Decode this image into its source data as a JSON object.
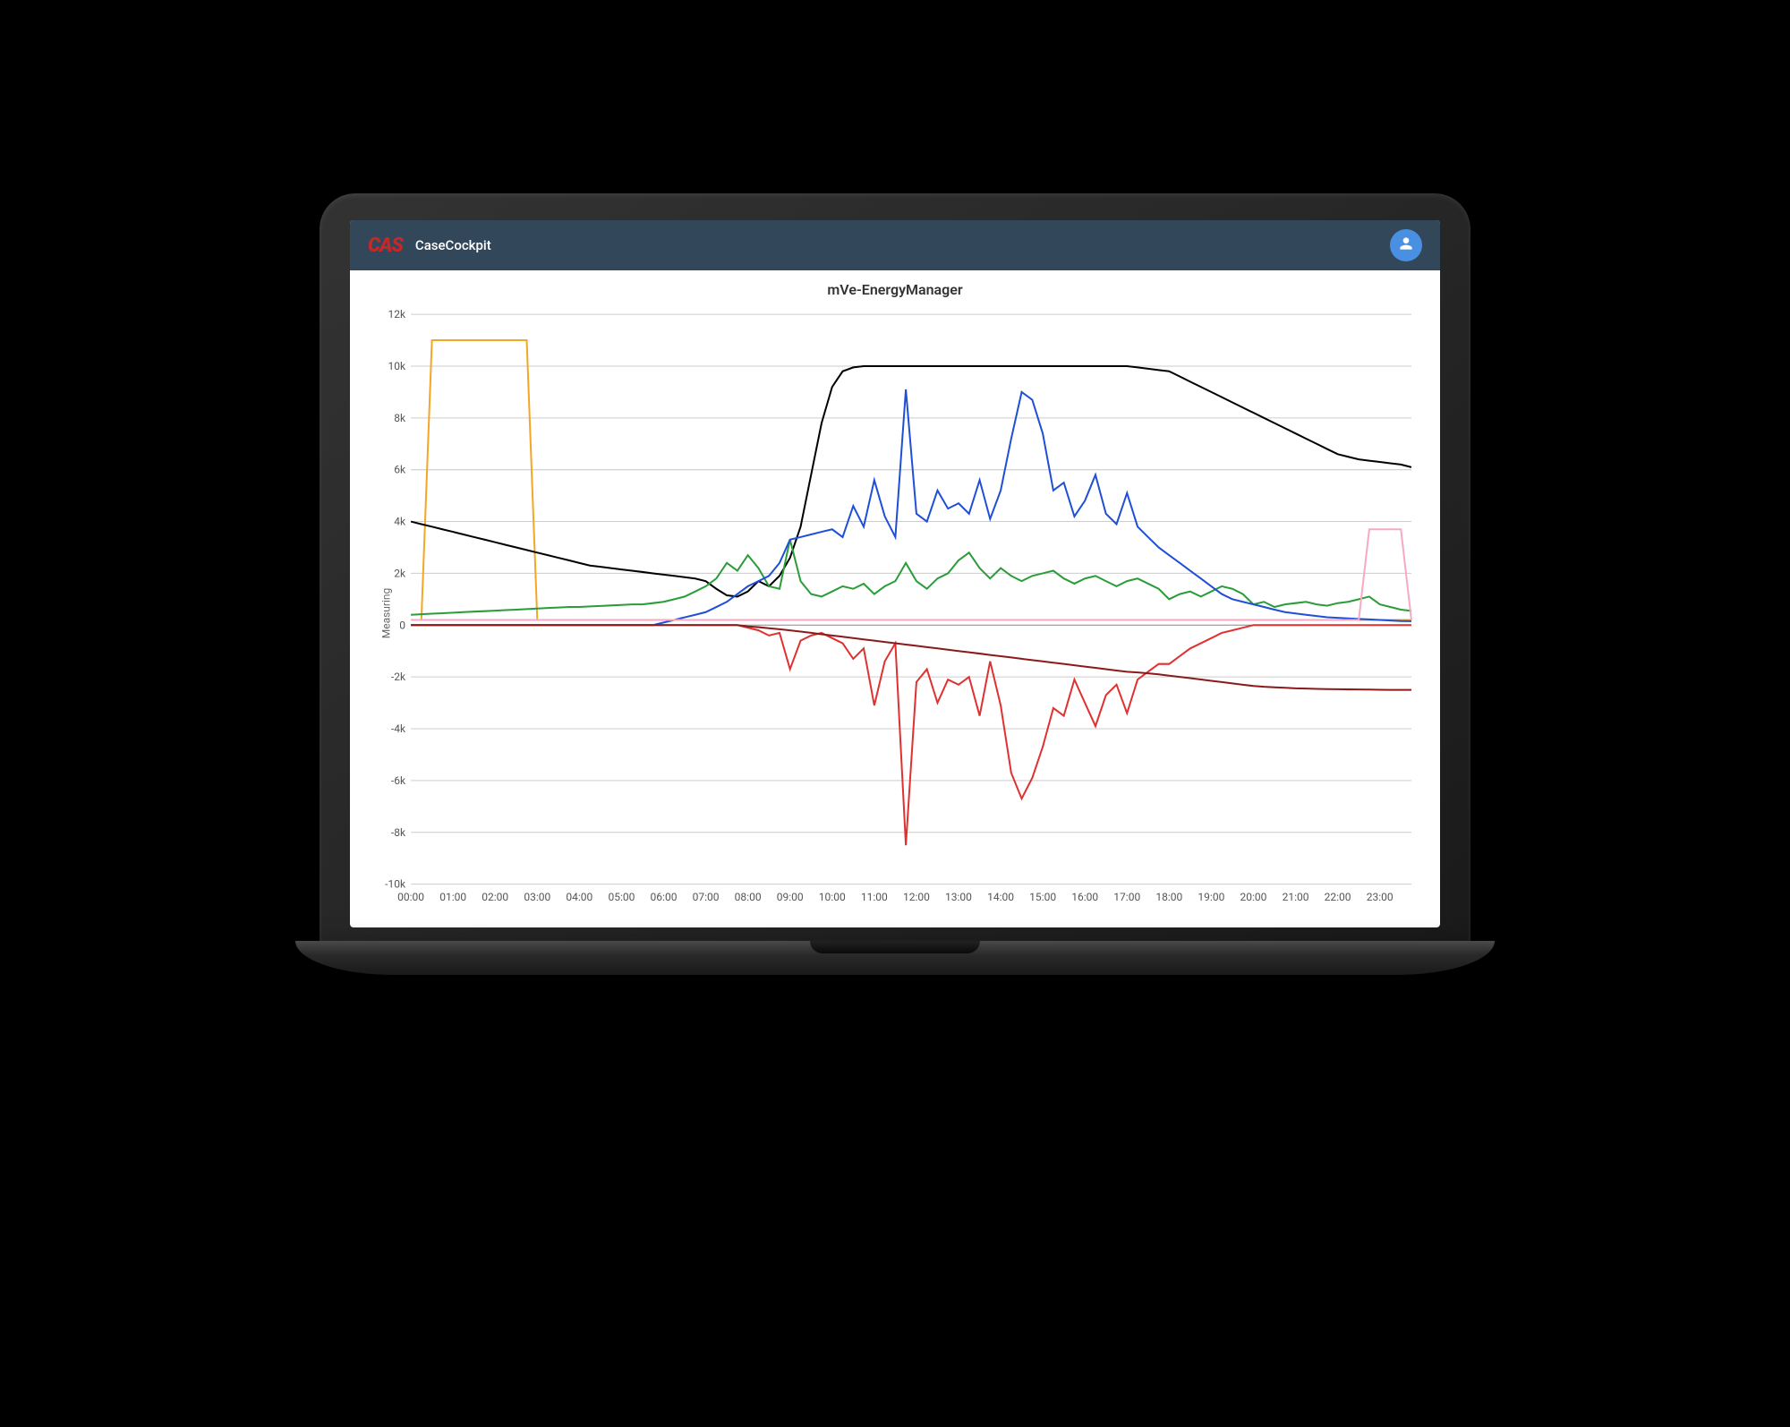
{
  "header": {
    "logo": "CAS",
    "app_name": "CaseCockpit"
  },
  "chart_data": {
    "type": "line",
    "title": "mVe-EnergyManager",
    "ylabel": "Measuring",
    "xlabel": "",
    "ylim": [
      -10000,
      12000
    ],
    "y_ticks": [
      -10000,
      -8000,
      -6000,
      -4000,
      -2000,
      0,
      2000,
      4000,
      6000,
      8000,
      10000,
      12000
    ],
    "y_tick_labels": [
      "-10k",
      "-8k",
      "-6k",
      "-4k",
      "-2k",
      "0",
      "2k",
      "4k",
      "6k",
      "8k",
      "10k",
      "12k"
    ],
    "x": [
      "00:00",
      "00:15",
      "00:30",
      "00:45",
      "01:00",
      "01:15",
      "01:30",
      "01:45",
      "02:00",
      "02:15",
      "02:30",
      "02:45",
      "03:00",
      "03:15",
      "03:30",
      "03:45",
      "04:00",
      "04:15",
      "04:30",
      "04:45",
      "05:00",
      "05:15",
      "05:30",
      "05:45",
      "06:00",
      "06:15",
      "06:30",
      "06:45",
      "07:00",
      "07:15",
      "07:30",
      "07:45",
      "08:00",
      "08:15",
      "08:30",
      "08:45",
      "09:00",
      "09:15",
      "09:30",
      "09:45",
      "10:00",
      "10:15",
      "10:30",
      "10:45",
      "11:00",
      "11:15",
      "11:30",
      "11:45",
      "12:00",
      "12:15",
      "12:30",
      "12:45",
      "13:00",
      "13:15",
      "13:30",
      "13:45",
      "14:00",
      "14:15",
      "14:30",
      "14:45",
      "15:00",
      "15:15",
      "15:30",
      "15:45",
      "16:00",
      "16:15",
      "16:30",
      "16:45",
      "17:00",
      "17:15",
      "17:30",
      "17:45",
      "18:00",
      "18:15",
      "18:30",
      "18:45",
      "19:00",
      "19:15",
      "19:30",
      "19:45",
      "20:00",
      "20:15",
      "20:30",
      "20:45",
      "21:00",
      "21:15",
      "21:30",
      "21:45",
      "22:00",
      "22:15",
      "22:30",
      "22:45",
      "23:00",
      "23:15",
      "23:30",
      "23:45"
    ],
    "x_tick_labels": [
      "00:00",
      "01:00",
      "02:00",
      "03:00",
      "04:00",
      "05:00",
      "06:00",
      "07:00",
      "08:00",
      "09:00",
      "10:00",
      "11:00",
      "12:00",
      "13:00",
      "14:00",
      "15:00",
      "16:00",
      "17:00",
      "18:00",
      "19:00",
      "20:00",
      "21:00",
      "22:00",
      "23:00"
    ],
    "series": [
      {
        "name": "orange",
        "color": "#f5a623",
        "values": [
          200,
          200,
          11000,
          11000,
          11000,
          11000,
          11000,
          11000,
          11000,
          11000,
          11000,
          11000,
          200,
          200,
          200,
          200,
          200,
          200,
          200,
          200,
          200,
          200,
          200,
          200,
          200,
          200,
          200,
          200,
          200,
          200,
          200,
          200,
          200,
          200,
          200,
          200,
          200,
          200,
          200,
          200,
          200,
          200,
          200,
          200,
          200,
          200,
          200,
          200,
          200,
          200,
          200,
          200,
          200,
          200,
          200,
          200,
          200,
          200,
          200,
          200,
          200,
          200,
          200,
          200,
          200,
          200,
          200,
          200,
          200,
          200,
          200,
          200,
          200,
          200,
          200,
          200,
          200,
          200,
          200,
          200,
          200,
          200,
          200,
          200,
          200,
          200,
          200,
          200,
          200,
          200,
          200,
          200,
          200,
          200,
          200,
          200
        ]
      },
      {
        "name": "black",
        "color": "#000000",
        "values": [
          4000,
          3900,
          3800,
          3700,
          3600,
          3500,
          3400,
          3300,
          3200,
          3100,
          3000,
          2900,
          2800,
          2700,
          2600,
          2500,
          2400,
          2300,
          2250,
          2200,
          2150,
          2100,
          2050,
          2000,
          1950,
          1900,
          1850,
          1800,
          1700,
          1400,
          1150,
          1100,
          1300,
          1700,
          1500,
          1900,
          2600,
          3800,
          5800,
          7800,
          9200,
          9800,
          9950,
          10000,
          10000,
          10000,
          10000,
          10000,
          10000,
          10000,
          10000,
          10000,
          10000,
          10000,
          10000,
          10000,
          10000,
          10000,
          10000,
          10000,
          10000,
          10000,
          10000,
          10000,
          10000,
          10000,
          10000,
          10000,
          10000,
          9950,
          9900,
          9850,
          9800,
          9600,
          9400,
          9200,
          9000,
          8800,
          8600,
          8400,
          8200,
          8000,
          7800,
          7600,
          7400,
          7200,
          7000,
          6800,
          6600,
          6500,
          6400,
          6350,
          6300,
          6250,
          6200,
          6100
        ]
      },
      {
        "name": "green",
        "color": "#2a9d3a",
        "values": [
          400,
          420,
          440,
          460,
          480,
          500,
          520,
          540,
          560,
          580,
          600,
          620,
          640,
          660,
          680,
          700,
          700,
          720,
          740,
          760,
          780,
          800,
          800,
          850,
          900,
          1000,
          1100,
          1300,
          1500,
          1800,
          2400,
          2100,
          2700,
          2200,
          1500,
          1400,
          3300,
          1700,
          1200,
          1100,
          1300,
          1500,
          1400,
          1600,
          1200,
          1500,
          1700,
          2400,
          1700,
          1400,
          1800,
          2000,
          2500,
          2800,
          2200,
          1800,
          2200,
          1900,
          1700,
          1900,
          2000,
          2100,
          1800,
          1600,
          1800,
          1900,
          1700,
          1500,
          1700,
          1800,
          1600,
          1400,
          1000,
          1200,
          1300,
          1100,
          1300,
          1500,
          1400,
          1200,
          800,
          900,
          700,
          800,
          850,
          900,
          800,
          750,
          850,
          900,
          1000,
          1100,
          800,
          700,
          600,
          550
        ]
      },
      {
        "name": "blue",
        "color": "#1f4fd6",
        "values": [
          0,
          0,
          0,
          0,
          0,
          0,
          0,
          0,
          0,
          0,
          0,
          0,
          0,
          0,
          0,
          0,
          0,
          0,
          0,
          0,
          0,
          0,
          0,
          0,
          100,
          200,
          300,
          400,
          500,
          700,
          900,
          1200,
          1500,
          1700,
          1900,
          2400,
          3300,
          3400,
          3500,
          3600,
          3700,
          3400,
          4600,
          3800,
          5600,
          4200,
          3400,
          9100,
          4300,
          4000,
          5200,
          4500,
          4700,
          4300,
          5600,
          4100,
          5200,
          7200,
          9000,
          8700,
          7400,
          5200,
          5500,
          4200,
          4800,
          5800,
          4300,
          3900,
          5100,
          3800,
          3400,
          3000,
          2700,
          2400,
          2100,
          1800,
          1500,
          1200,
          1000,
          900,
          800,
          700,
          600,
          500,
          450,
          400,
          350,
          300,
          280,
          260,
          240,
          220,
          200,
          180,
          160,
          150
        ]
      },
      {
        "name": "red",
        "color": "#e03131",
        "values": [
          0,
          0,
          0,
          0,
          0,
          0,
          0,
          0,
          0,
          0,
          0,
          0,
          0,
          0,
          0,
          0,
          0,
          0,
          0,
          0,
          0,
          0,
          0,
          0,
          0,
          0,
          0,
          0,
          0,
          0,
          0,
          0,
          -100,
          -200,
          -400,
          -300,
          -1700,
          -600,
          -400,
          -300,
          -500,
          -700,
          -1300,
          -900,
          -3100,
          -1400,
          -700,
          -8500,
          -2200,
          -1700,
          -3000,
          -2100,
          -2300,
          -2000,
          -3500,
          -1400,
          -3100,
          -5700,
          -6700,
          -5900,
          -4700,
          -3200,
          -3500,
          -2100,
          -3000,
          -3900,
          -2700,
          -2300,
          -3400,
          -2100,
          -1800,
          -1500,
          -1500,
          -1200,
          -900,
          -700,
          -500,
          -300,
          -200,
          -100,
          0,
          0,
          0,
          0,
          0,
          0,
          0,
          0,
          0,
          0,
          0,
          0,
          0,
          0,
          0,
          0
        ]
      },
      {
        "name": "darkred",
        "color": "#8b1a1a",
        "values": [
          0,
          0,
          0,
          0,
          0,
          0,
          0,
          0,
          0,
          0,
          0,
          0,
          0,
          0,
          0,
          0,
          0,
          0,
          0,
          0,
          0,
          0,
          0,
          0,
          0,
          0,
          0,
          0,
          0,
          0,
          0,
          0,
          -50,
          -80,
          -120,
          -160,
          -200,
          -250,
          -300,
          -350,
          -400,
          -450,
          -500,
          -550,
          -600,
          -650,
          -700,
          -750,
          -800,
          -850,
          -900,
          -950,
          -1000,
          -1050,
          -1100,
          -1150,
          -1200,
          -1250,
          -1300,
          -1350,
          -1400,
          -1450,
          -1500,
          -1550,
          -1600,
          -1650,
          -1700,
          -1750,
          -1800,
          -1830,
          -1860,
          -1900,
          -1950,
          -2000,
          -2050,
          -2100,
          -2150,
          -2200,
          -2250,
          -2300,
          -2350,
          -2380,
          -2400,
          -2420,
          -2440,
          -2450,
          -2460,
          -2470,
          -2475,
          -2480,
          -2485,
          -2490,
          -2495,
          -2500,
          -2500,
          -2500
        ]
      },
      {
        "name": "pink",
        "color": "#f7a9c4",
        "values": [
          200,
          200,
          200,
          200,
          200,
          200,
          200,
          200,
          200,
          200,
          200,
          200,
          200,
          200,
          200,
          200,
          200,
          200,
          200,
          200,
          200,
          200,
          200,
          200,
          200,
          200,
          200,
          200,
          200,
          200,
          200,
          200,
          200,
          200,
          200,
          200,
          200,
          200,
          200,
          200,
          200,
          200,
          200,
          200,
          200,
          200,
          200,
          200,
          200,
          200,
          200,
          200,
          200,
          200,
          200,
          200,
          200,
          200,
          200,
          200,
          200,
          200,
          200,
          200,
          200,
          200,
          200,
          200,
          200,
          200,
          200,
          200,
          200,
          200,
          200,
          200,
          200,
          200,
          200,
          200,
          200,
          200,
          200,
          200,
          200,
          200,
          200,
          200,
          200,
          200,
          200,
          3700,
          3700,
          3700,
          3700,
          200
        ]
      }
    ]
  }
}
